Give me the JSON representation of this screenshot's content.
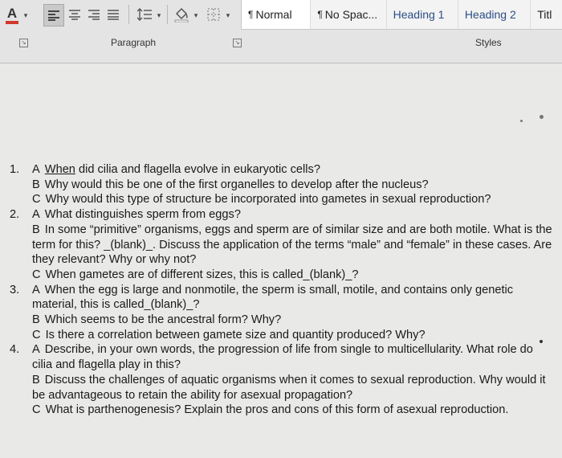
{
  "ribbon": {
    "font_color_button": "A",
    "font_color_icon": "font-color-icon",
    "paragraph_label": "Paragraph",
    "styles_label": "Styles",
    "styles": [
      {
        "mark": "¶",
        "label": "Normal"
      },
      {
        "mark": "¶",
        "label": "No Spac..."
      },
      {
        "mark": "",
        "label": "Heading 1"
      },
      {
        "mark": "",
        "label": "Heading 2"
      },
      {
        "mark": "",
        "label": "Titl"
      }
    ]
  },
  "document": {
    "questions": [
      {
        "number": "1.",
        "parts": [
          {
            "letter": "A",
            "text": "When did cilia and flagella evolve in eukaryotic cells?",
            "underline": "When"
          },
          {
            "letter": "B",
            "text": "Why would this be one of the first organelles to develop after the nucleus?"
          },
          {
            "letter": "C",
            "text": "Why would this type of structure be incorporated into gametes in sexual reproduction?"
          }
        ]
      },
      {
        "number": "2.",
        "parts": [
          {
            "letter": "A",
            "text": "What distinguishes sperm from eggs?"
          },
          {
            "letter": "B",
            "text": "In some “primitive” organisms, eggs and sperm are of similar size and are both motile. What is the term for this? _(blank)_. Discuss the application of the terms “male” and “female” in these cases. Are they relevant? Why or why not?"
          },
          {
            "letter": "C",
            "text": "When gametes are of different sizes, this is called_(blank)_?"
          }
        ]
      },
      {
        "number": "3.",
        "parts": [
          {
            "letter": "A",
            "text": "When the egg is large and nonmotile, the sperm is small, motile, and contains only genetic material, this is called_(blank)_?"
          },
          {
            "letter": "B",
            "text": "Which seems to be the ancestral form? Why?"
          },
          {
            "letter": "C",
            "text": "Is there a correlation between gamete size and quantity produced? Why?"
          }
        ]
      },
      {
        "number": "4.",
        "parts": [
          {
            "letter": "A",
            "text": "Describe, in your own words, the progression of life from single to multicellularity. What role do cilia and flagella play in this?"
          },
          {
            "letter": "B",
            "text": "Discuss the challenges of aquatic organisms when it comes to sexual reproduction. Why would it be advantageous to retain the ability for asexual propagation?"
          },
          {
            "letter": "C",
            "text": "What is parthenogenesis? Explain the pros and cons of this form of asexual reproduction."
          }
        ]
      }
    ]
  }
}
